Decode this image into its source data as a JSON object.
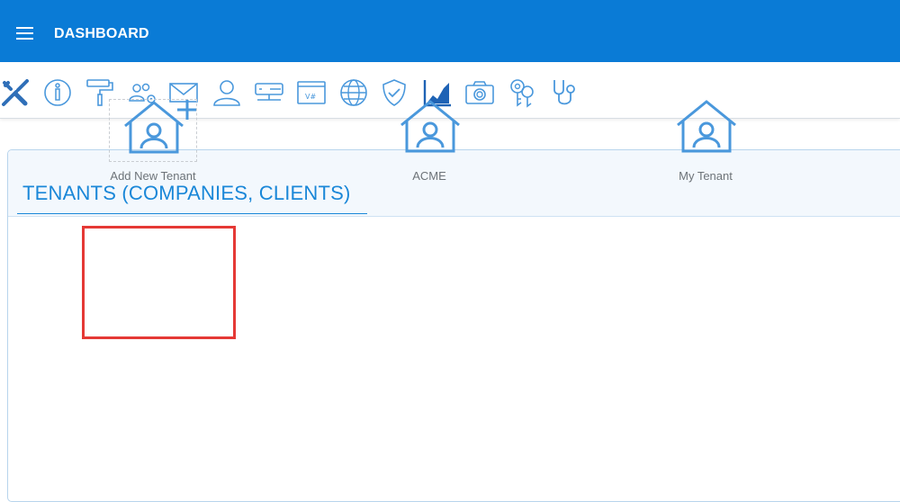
{
  "header": {
    "title": "DASHBOARD"
  },
  "toolbar": {
    "icons": [
      "tools-icon",
      "info-icon",
      "paint-roller-icon",
      "users-settings-icon",
      "mail-icon",
      "user-icon",
      "server-icon",
      "code-window-icon",
      "globe-icon",
      "shield-check-icon",
      "chart-icon",
      "camera-icon",
      "keys-icon",
      "stethoscope-icon"
    ]
  },
  "panel": {
    "title": "TENANTS (COMPANIES, CLIENTS)",
    "tiles": [
      {
        "label": "Add New Tenant",
        "icon": "add-tenant-icon"
      },
      {
        "label": "ACME",
        "icon": "tenant-house-icon"
      },
      {
        "label": "My Tenant",
        "icon": "tenant-house-icon"
      }
    ]
  },
  "colors": {
    "header_bg": "#0a7bd6",
    "accent": "#1a87d8",
    "icon": "#4a98dc",
    "highlight": "#e53935"
  }
}
